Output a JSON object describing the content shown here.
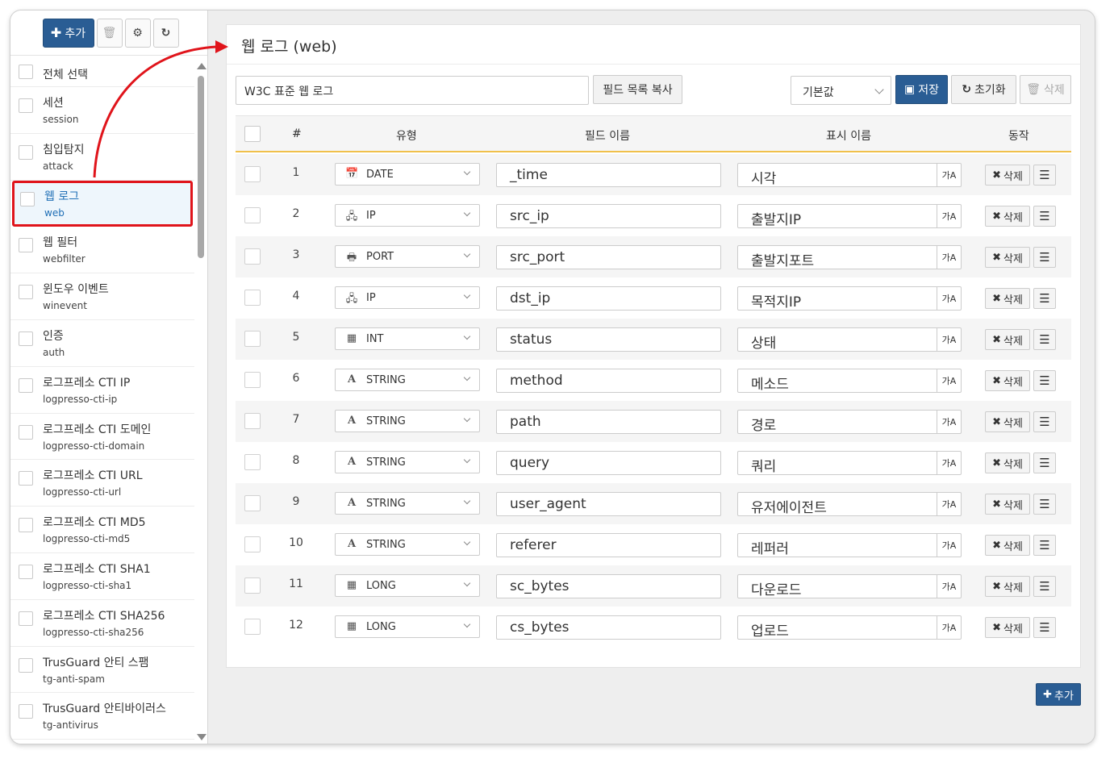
{
  "sidebar": {
    "toolbar": {
      "add_label": "추가"
    },
    "select_all_label": "전체 선택",
    "items": [
      {
        "name": "세션",
        "code": "session"
      },
      {
        "name": "침입탐지",
        "code": "attack"
      },
      {
        "name": "웹 로그",
        "code": "web"
      },
      {
        "name": "웹 필터",
        "code": "webfilter"
      },
      {
        "name": "윈도우 이벤트",
        "code": "winevent"
      },
      {
        "name": "인증",
        "code": "auth"
      },
      {
        "name": "로그프레소 CTI IP",
        "code": "logpresso-cti-ip"
      },
      {
        "name": "로그프레소 CTI 도메인",
        "code": "logpresso-cti-domain"
      },
      {
        "name": "로그프레소 CTI URL",
        "code": "logpresso-cti-url"
      },
      {
        "name": "로그프레소 CTI MD5",
        "code": "logpresso-cti-md5"
      },
      {
        "name": "로그프레소 CTI SHA1",
        "code": "logpresso-cti-sha1"
      },
      {
        "name": "로그프레소 CTI SHA256",
        "code": "logpresso-cti-sha256"
      },
      {
        "name": "TrusGuard 안티 스팸",
        "code": "tg-anti-spam"
      },
      {
        "name": "TrusGuard 안티바이러스",
        "code": "tg-antivirus"
      }
    ]
  },
  "panel": {
    "title": "웹 로그 (web)",
    "description": "W3C 표준 웹 로그",
    "copy_fields_label": "필드 목록 복사",
    "default_select": "기본값",
    "save_label": "저장",
    "reset_label": "초기화",
    "delete_label": "삭제"
  },
  "table": {
    "headers": {
      "num": "#",
      "type": "유형",
      "field": "필드 이름",
      "display": "표시 이름",
      "action": "동작"
    },
    "delete_label": "삭제",
    "translate_glyph": "가A",
    "rows": [
      {
        "num": "1",
        "type": "DATE",
        "icon": "calendar-icon",
        "field": "_time",
        "display": "시각"
      },
      {
        "num": "2",
        "type": "IP",
        "icon": "network-icon",
        "field": "src_ip",
        "display": "출발지IP"
      },
      {
        "num": "3",
        "type": "PORT",
        "icon": "port-icon",
        "field": "src_port",
        "display": "출발지포트"
      },
      {
        "num": "4",
        "type": "IP",
        "icon": "network-icon",
        "field": "dst_ip",
        "display": "목적지IP"
      },
      {
        "num": "5",
        "type": "INT",
        "icon": "calculator-icon",
        "field": "status",
        "display": "상태"
      },
      {
        "num": "6",
        "type": "STRING",
        "icon": "font-icon",
        "field": "method",
        "display": "메소드"
      },
      {
        "num": "7",
        "type": "STRING",
        "icon": "font-icon",
        "field": "path",
        "display": "경로"
      },
      {
        "num": "8",
        "type": "STRING",
        "icon": "font-icon",
        "field": "query",
        "display": "쿼리"
      },
      {
        "num": "9",
        "type": "STRING",
        "icon": "font-icon",
        "field": "user_agent",
        "display": "유저에이전트"
      },
      {
        "num": "10",
        "type": "STRING",
        "icon": "font-icon",
        "field": "referer",
        "display": "레퍼러"
      },
      {
        "num": "11",
        "type": "LONG",
        "icon": "calculator-icon",
        "field": "sc_bytes",
        "display": "다운로드"
      },
      {
        "num": "12",
        "type": "LONG",
        "icon": "calculator-icon",
        "field": "cs_bytes",
        "display": "업로드"
      }
    ]
  },
  "footer": {
    "add_label": "추가"
  },
  "colors": {
    "primary": "#2a5d94",
    "highlight": "#e0141b",
    "header_border": "#f0c04a"
  }
}
